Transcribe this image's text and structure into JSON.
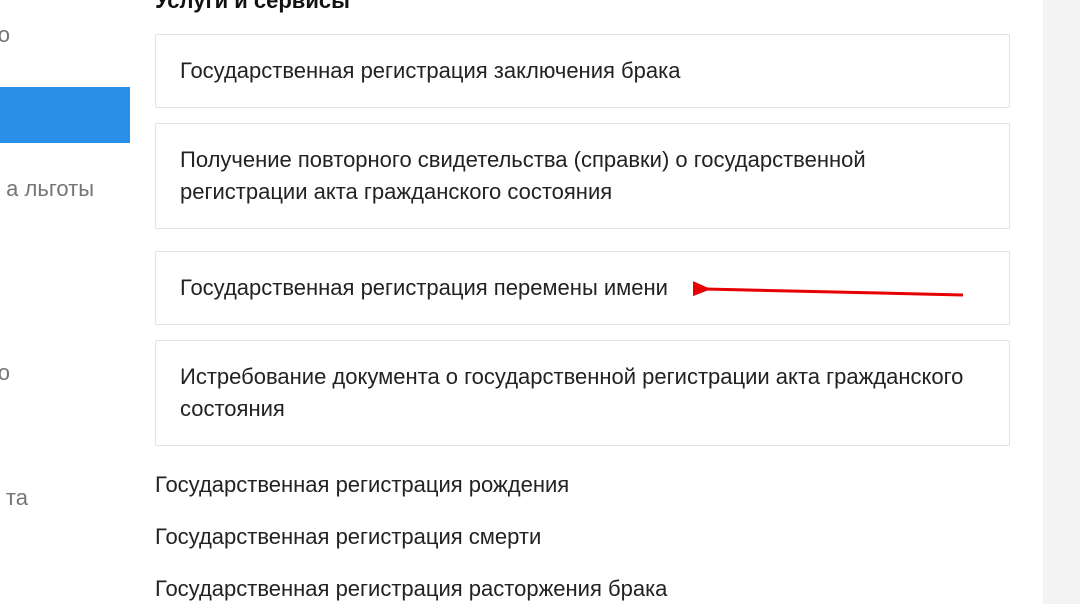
{
  "section_title": "Услуги и сервисы",
  "sidebar": {
    "item_partial_1": "о",
    "item_partial_2": "а льготы",
    "item_partial_3": "о",
    "item_partial_4": "та"
  },
  "cards": {
    "c1": "Государственная регистрация заключения брака",
    "c2": "Получение повторного свидетельства (справки) о государственной регистрации акта гражданского состояния",
    "c3": "Государственная регистрация перемены имени",
    "c4": "Истребование документа о государственной регистрации акта гражданского состояния"
  },
  "links": {
    "l1": "Государственная регистрация рождения",
    "l2": "Государственная регистрация смерти",
    "l3": "Государственная регистрация расторжения брака"
  },
  "annotation": {
    "arrow_color": "#e60000"
  }
}
